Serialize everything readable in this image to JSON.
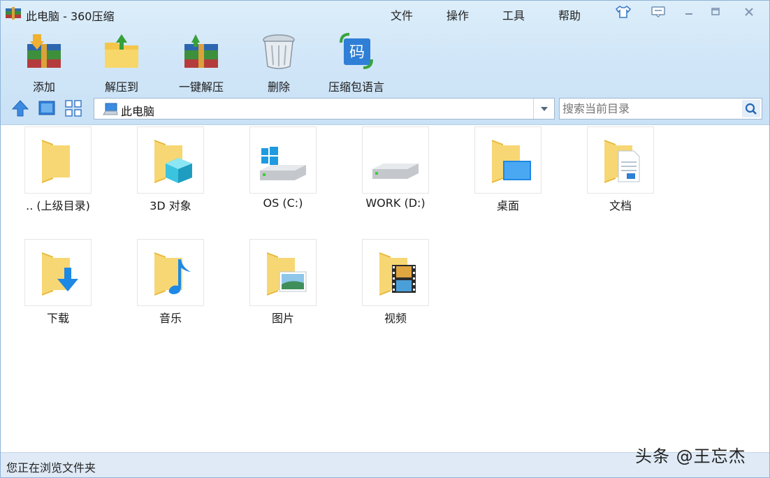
{
  "window": {
    "title": "此电脑 - 360压缩"
  },
  "menu": [
    "文件",
    "操作",
    "工具",
    "帮助"
  ],
  "toolbar": [
    {
      "label": "添加",
      "icon": "add-archive-icon"
    },
    {
      "label": "解压到",
      "icon": "extract-to-icon"
    },
    {
      "label": "一键解压",
      "icon": "one-click-extract-icon"
    },
    {
      "label": "删除",
      "icon": "delete-trash-icon"
    },
    {
      "label": "压缩包语言",
      "icon": "archive-language-icon"
    }
  ],
  "address": {
    "path": "此电脑"
  },
  "search": {
    "placeholder": "搜索当前目录"
  },
  "items": [
    {
      "label": ".. (上级目录)",
      "icon": "parent-folder-icon"
    },
    {
      "label": "3D 对象",
      "icon": "3d-objects-folder-icon"
    },
    {
      "label": "OS (C:)",
      "icon": "windows-drive-icon"
    },
    {
      "label": "WORK (D:)",
      "icon": "drive-icon"
    },
    {
      "label": "桌面",
      "icon": "desktop-folder-icon"
    },
    {
      "label": "文档",
      "icon": "documents-folder-icon"
    },
    {
      "label": "下载",
      "icon": "downloads-folder-icon"
    },
    {
      "label": "音乐",
      "icon": "music-folder-icon"
    },
    {
      "label": "图片",
      "icon": "pictures-folder-icon"
    },
    {
      "label": "视频",
      "icon": "videos-folder-icon"
    }
  ],
  "status": {
    "text": "您正在浏览文件夹"
  },
  "watermark": {
    "text": "头条 @王忘杰"
  },
  "colors": {
    "chrome": "#d2e7f8",
    "folder": "#f7d774",
    "accent": "#1e88e5"
  }
}
